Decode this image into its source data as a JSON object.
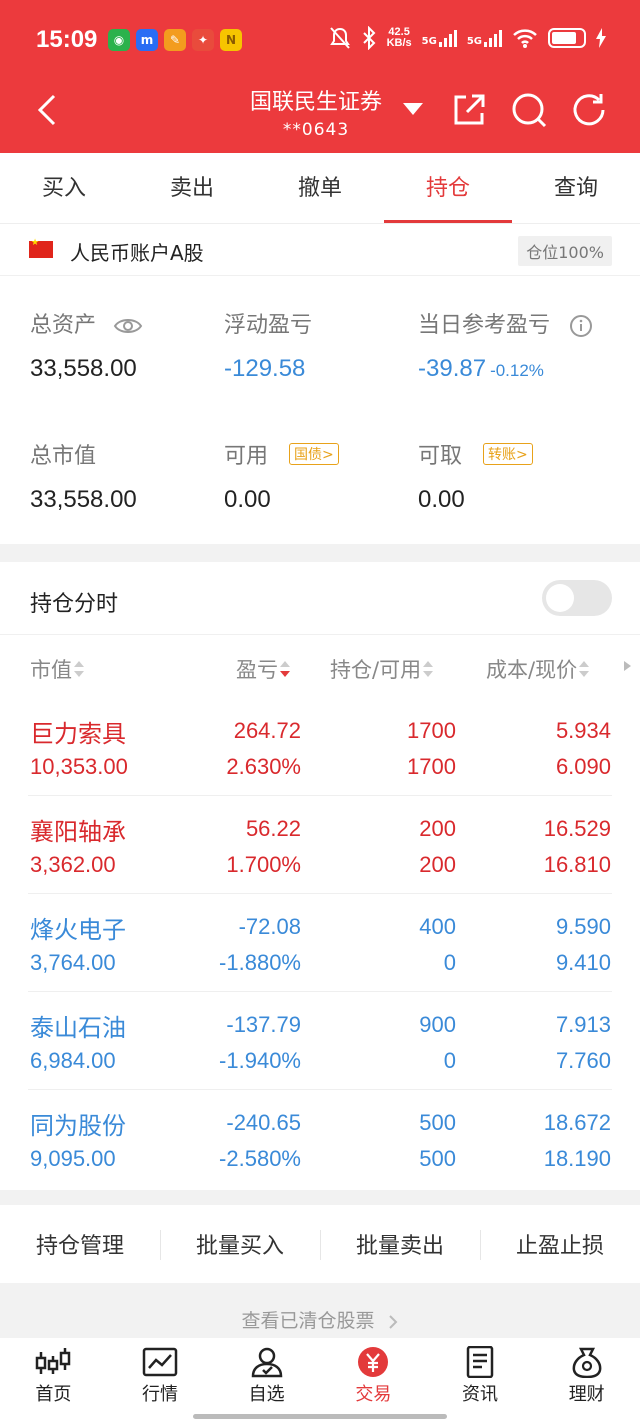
{
  "status_bar": {
    "time": "15:09",
    "net_speed_value": "42.5",
    "net_speed_unit": "KB/s",
    "sig1": "5G",
    "sig2": "5G"
  },
  "header": {
    "broker": "国联民生证券",
    "account": "**0643"
  },
  "tabs": [
    {
      "label": "买入"
    },
    {
      "label": "卖出"
    },
    {
      "label": "撤单"
    },
    {
      "label": "持仓",
      "active": true
    },
    {
      "label": "查询"
    }
  ],
  "account": {
    "type": "人民币账户A股",
    "position_badge": "仓位100%",
    "total_assets_label": "总资产",
    "total_assets": "33,558.00",
    "floating_pl_label": "浮动盈亏",
    "floating_pl": "-129.58",
    "daily_pl_label": "当日参考盈亏",
    "daily_pl": "-39.87",
    "daily_pl_pct": "-0.12%",
    "market_value_label": "总市值",
    "market_value": "33,558.00",
    "available_label": "可用",
    "available_tag": "国债>",
    "available": "0.00",
    "withdrawable_label": "可取",
    "withdrawable_tag": "转账>",
    "withdrawable": "0.00"
  },
  "holdings": {
    "title": "持仓分时",
    "headers": {
      "market_value": "市值",
      "pl": "盈亏",
      "position": "持仓/可用",
      "cost": "成本/现价"
    },
    "rows": [
      {
        "name": "巨力索具",
        "market_value": "10,353.00",
        "pl": "264.72",
        "pl_pct": "2.630%",
        "position": "1700",
        "available": "1700",
        "cost": "5.934",
        "price": "6.090",
        "trend": "up"
      },
      {
        "name": "襄阳轴承",
        "market_value": "3,362.00",
        "pl": "56.22",
        "pl_pct": "1.700%",
        "position": "200",
        "available": "200",
        "cost": "16.529",
        "price": "16.810",
        "trend": "up"
      },
      {
        "name": "烽火电子",
        "market_value": "3,764.00",
        "pl": "-72.08",
        "pl_pct": "-1.880%",
        "position": "400",
        "available": "0",
        "cost": "9.590",
        "price": "9.410",
        "trend": "down"
      },
      {
        "name": "泰山石油",
        "market_value": "6,984.00",
        "pl": "-137.79",
        "pl_pct": "-1.940%",
        "position": "900",
        "available": "0",
        "cost": "7.913",
        "price": "7.760",
        "trend": "down"
      },
      {
        "name": "同为股份",
        "market_value": "9,095.00",
        "pl": "-240.65",
        "pl_pct": "-2.580%",
        "position": "500",
        "available": "500",
        "cost": "18.672",
        "price": "18.190",
        "trend": "down"
      }
    ]
  },
  "actions": [
    "持仓管理",
    "批量买入",
    "批量卖出",
    "止盈止损"
  ],
  "cleared_link": "查看已清仓股票",
  "bottom_nav": [
    {
      "label": "首页",
      "icon": "candlestick-icon"
    },
    {
      "label": "行情",
      "icon": "chart-line-icon"
    },
    {
      "label": "自选",
      "icon": "user-icon"
    },
    {
      "label": "交易",
      "icon": "yuan-icon",
      "active": true
    },
    {
      "label": "资讯",
      "icon": "document-icon"
    },
    {
      "label": "理财",
      "icon": "money-bag-icon"
    }
  ],
  "colors": {
    "brand_red": "#ec3a3d",
    "gain_red": "#d9292d",
    "loss_blue": "#3a8ad8",
    "tag_orange": "#e8a21a"
  }
}
